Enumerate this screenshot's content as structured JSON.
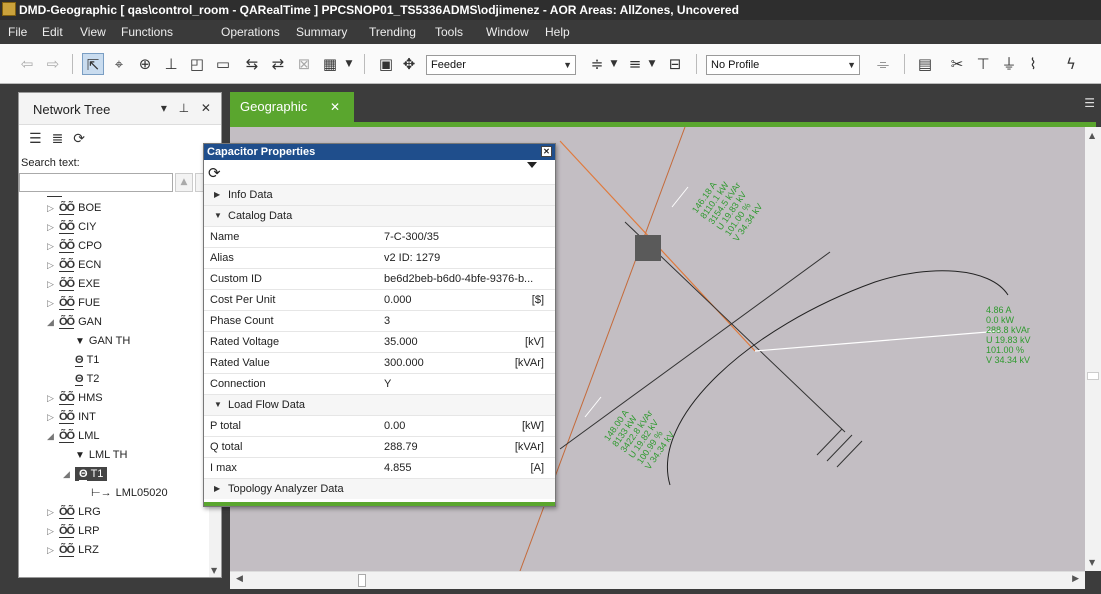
{
  "window": {
    "title": "DMD-Geographic [ qas\\control_room - QARealTime ] PPCSNOP01_TS5336ADMS\\odjimenez - AOR Areas: AllZones, Uncovered"
  },
  "menu": [
    "File",
    "Edit",
    "View",
    "Functions",
    "Operations",
    "Summary",
    "Trending",
    "Tools",
    "Window",
    "Help"
  ],
  "toolbar": {
    "feeder_combo": "Feeder",
    "profile_combo": "No Profile"
  },
  "network_tree": {
    "title": "Network Tree",
    "pin_label": "▾ ⊥ ✕",
    "search_label": "Search text:",
    "items": [
      {
        "label": "BOE",
        "type": "substation",
        "expanded": false
      },
      {
        "label": "CIY",
        "type": "substation",
        "expanded": false
      },
      {
        "label": "CPO",
        "type": "substation",
        "expanded": false
      },
      {
        "label": "ECN",
        "type": "substation",
        "expanded": false
      },
      {
        "label": "EXE",
        "type": "substation",
        "expanded": false
      },
      {
        "label": "FUE",
        "type": "substation",
        "expanded": false
      },
      {
        "label": "GAN",
        "type": "substation",
        "expanded": true
      },
      {
        "label": "GAN TH",
        "type": "group"
      },
      {
        "label": "T1",
        "type": "transformer"
      },
      {
        "label": "T2",
        "type": "transformer"
      },
      {
        "label": "HMS",
        "type": "substation",
        "expanded": false
      },
      {
        "label": "INT",
        "type": "substation",
        "expanded": false
      },
      {
        "label": "LML",
        "type": "substation",
        "expanded": true
      },
      {
        "label": "LML TH",
        "type": "group"
      },
      {
        "label": "T1",
        "type": "transformer",
        "selected": true
      },
      {
        "label": "LML05020",
        "type": "feeder"
      },
      {
        "label": "LRG",
        "type": "substation",
        "expanded": false
      },
      {
        "label": "LRP",
        "type": "substation",
        "expanded": false
      },
      {
        "label": "LRZ",
        "type": "substation",
        "expanded": false
      }
    ]
  },
  "tabs": [
    {
      "label": "Geographic",
      "active": true
    }
  ],
  "capacitor_dialog": {
    "title": "Capacitor Properties",
    "sections": {
      "info": "Info Data",
      "catalog": "Catalog Data",
      "loadflow": "Load Flow Data",
      "topology": "Topology Analyzer Data"
    },
    "catalog_rows": [
      {
        "key": "Name",
        "value": "7-C-300/35",
        "unit": ""
      },
      {
        "key": "Alias",
        "value": "v2 ID: 1279",
        "unit": ""
      },
      {
        "key": "Custom ID",
        "value": "be6d2beb-b6d0-4bfe-9376-b...",
        "unit": ""
      },
      {
        "key": "Cost Per Unit",
        "value": "0.000",
        "unit": "[$]"
      },
      {
        "key": "Phase Count",
        "value": "3",
        "unit": ""
      },
      {
        "key": "Rated Voltage",
        "value": "35.000",
        "unit": "[kV]"
      },
      {
        "key": "Rated Value",
        "value": "300.000",
        "unit": "[kVAr]"
      },
      {
        "key": "Connection",
        "value": "Y",
        "unit": ""
      }
    ],
    "loadflow_rows": [
      {
        "key": "P total",
        "value": "0.00",
        "unit": "[kW]"
      },
      {
        "key": "Q total",
        "value": "288.79",
        "unit": "[kVAr]"
      },
      {
        "key": "I max",
        "value": "4.855",
        "unit": "[A]"
      }
    ]
  },
  "canvas_annotations": {
    "right_block": [
      "4.86 A",
      "0.0 kW",
      "288.8 kVAr",
      "U 19.83 kV",
      "101.00 %",
      "V 34.34 kV"
    ],
    "top_block": [
      "146.18 A",
      "8110.1 kW",
      "3154.5 kVAr",
      "U 19.83 kV",
      "101.00 %",
      "V 34.34 kV"
    ],
    "bottom_block": [
      "148.00 A",
      "8133 kW",
      "3422.8 kVAr",
      "U 19.82 kV",
      "100.99 %",
      "V 34.34 kV"
    ]
  },
  "colors": {
    "accent_green": "#5aa62e",
    "dialog_title": "#1f4e8c",
    "annotation_green": "#2e9a2e",
    "line_orange": "#e07a3c"
  }
}
